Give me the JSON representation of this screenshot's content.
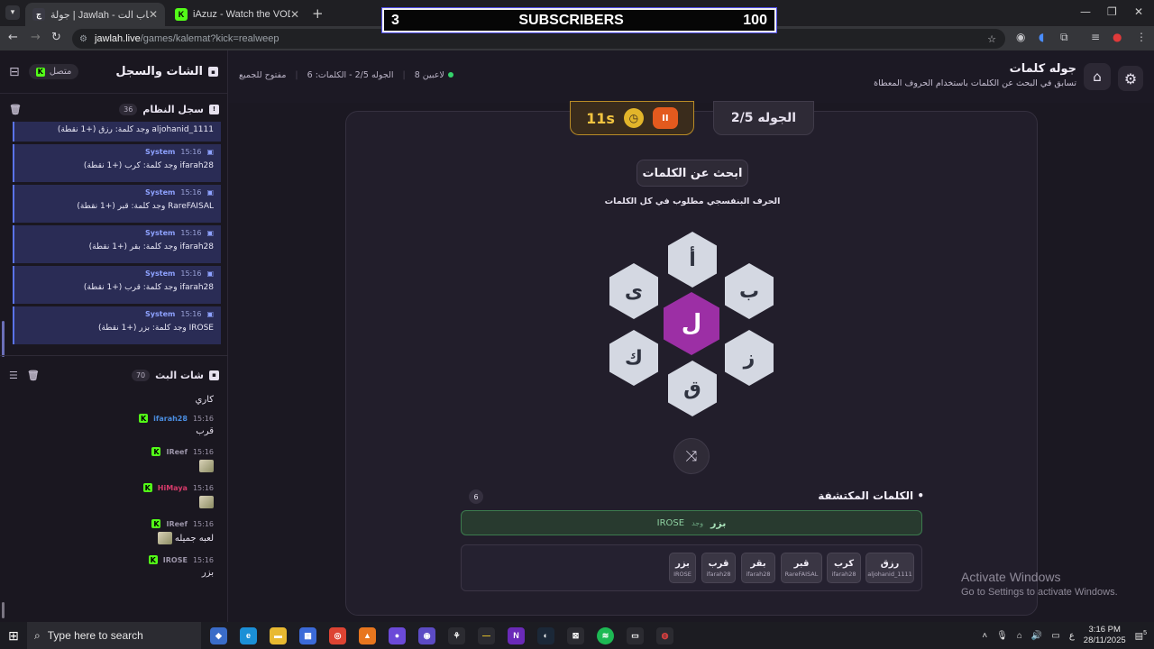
{
  "browser": {
    "tabs": [
      {
        "title": "جولة | Jawlah - منصة الألعاب الت...",
        "favicon_color": "#3a3a44",
        "active": true
      },
      {
        "title": "iAzuz - Watch the VOD on Kick",
        "favicon_color": "#53fc18",
        "active": false
      }
    ],
    "new_tab": "+",
    "url_host": "jawlah.live",
    "url_path": "/games/kalemat?kick=realweep",
    "controls": {
      "minimize": "—",
      "maximize": "❐",
      "close": "✕"
    }
  },
  "overlay": {
    "left": "3",
    "label": "SUBSCRIBERS",
    "right": "100"
  },
  "sidebar": {
    "title": "الشات والسجل",
    "status": "متصل",
    "system_log": {
      "title": "سجل النظام",
      "count": "36",
      "items": [
        {
          "time": "",
          "who": "",
          "text": "aljohanid_1111 وجد كلمة: رزق (+1 نقطة)"
        },
        {
          "time": "15:16",
          "who": "System",
          "text": "ifarah28 وجد كلمة: كرب (+1 نقطة)"
        },
        {
          "time": "15:16",
          "who": "System",
          "text": "RareFAISAL وجد كلمة: قبر (+1 نقطة)"
        },
        {
          "time": "15:16",
          "who": "System",
          "text": "ifarah28 وجد كلمة: بقر (+1 نقطة)"
        },
        {
          "time": "15:16",
          "who": "System",
          "text": "ifarah28 وجد كلمة: قرب (+1 نقطة)"
        },
        {
          "time": "15:16",
          "who": "System",
          "text": "IROSE وجد كلمة: بزر (+1 نقطة)"
        }
      ]
    },
    "stream_chat": {
      "title": "شات البث",
      "count": "70",
      "messages": [
        {
          "time": "",
          "user": "",
          "user_color": "#e6e1ee",
          "text": "كاري",
          "emote": false
        },
        {
          "time": "15:16",
          "user": "ifarah28",
          "user_color": "#4a8de0",
          "text": "قرب",
          "emote": false
        },
        {
          "time": "15:16",
          "user": "IReef",
          "user_color": "#e6e1ee",
          "text": "",
          "emote": true
        },
        {
          "time": "15:16",
          "user": "HiMaya",
          "user_color": "#d63a6a",
          "text": "",
          "emote": true
        },
        {
          "time": "15:16",
          "user": "IReef",
          "user_color": "#e6e1ee",
          "text": "لعبه جميله",
          "emote": true
        },
        {
          "time": "15:16",
          "user": "IROSE",
          "user_color": "#e6e1ee",
          "text": "بزر",
          "emote": false
        }
      ]
    }
  },
  "header": {
    "title": "جوله كلمات",
    "subtitle": "تسابق في البحث عن الكلمات باستخدام الحروف المعطاة",
    "players": "8 لاعبين",
    "round_info": "الجوله 2/5 - الكلمات: 6",
    "mode": "مفتوح للجميع"
  },
  "game": {
    "timer": "11s",
    "round": "الجوله 2/5",
    "find_button": "ابحث عن الكلمات",
    "hint": "الحرف البنفسجي مطلوب في كل الكلمات",
    "center_letter": "ل",
    "letters": {
      "top": "أ",
      "top_right": "ب",
      "bottom_right": "ز",
      "bottom": "ق",
      "bottom_left": "ك",
      "top_left": "ى"
    },
    "found_title": "• الكلمات المكتشفة",
    "found_count": "6",
    "last_found": {
      "user": "IROSE",
      "verb": "وجد",
      "word": "بزر"
    },
    "words": [
      {
        "word": "رزق",
        "by": "aljohanid_1111"
      },
      {
        "word": "كرب",
        "by": "ifarah28"
      },
      {
        "word": "قبر",
        "by": "RareFAISAL"
      },
      {
        "word": "بقر",
        "by": "ifarah28"
      },
      {
        "word": "قرب",
        "by": "ifarah28"
      },
      {
        "word": "بزر",
        "by": "IROSE"
      }
    ]
  },
  "watermark": {
    "line1": "Activate Windows",
    "line2": "Go to Settings to activate Windows."
  },
  "taskbar": {
    "search_placeholder": "Type here to search",
    "time": "3:16 PM",
    "date": "28/11/2025",
    "lang": "ع",
    "notifications": "5"
  }
}
